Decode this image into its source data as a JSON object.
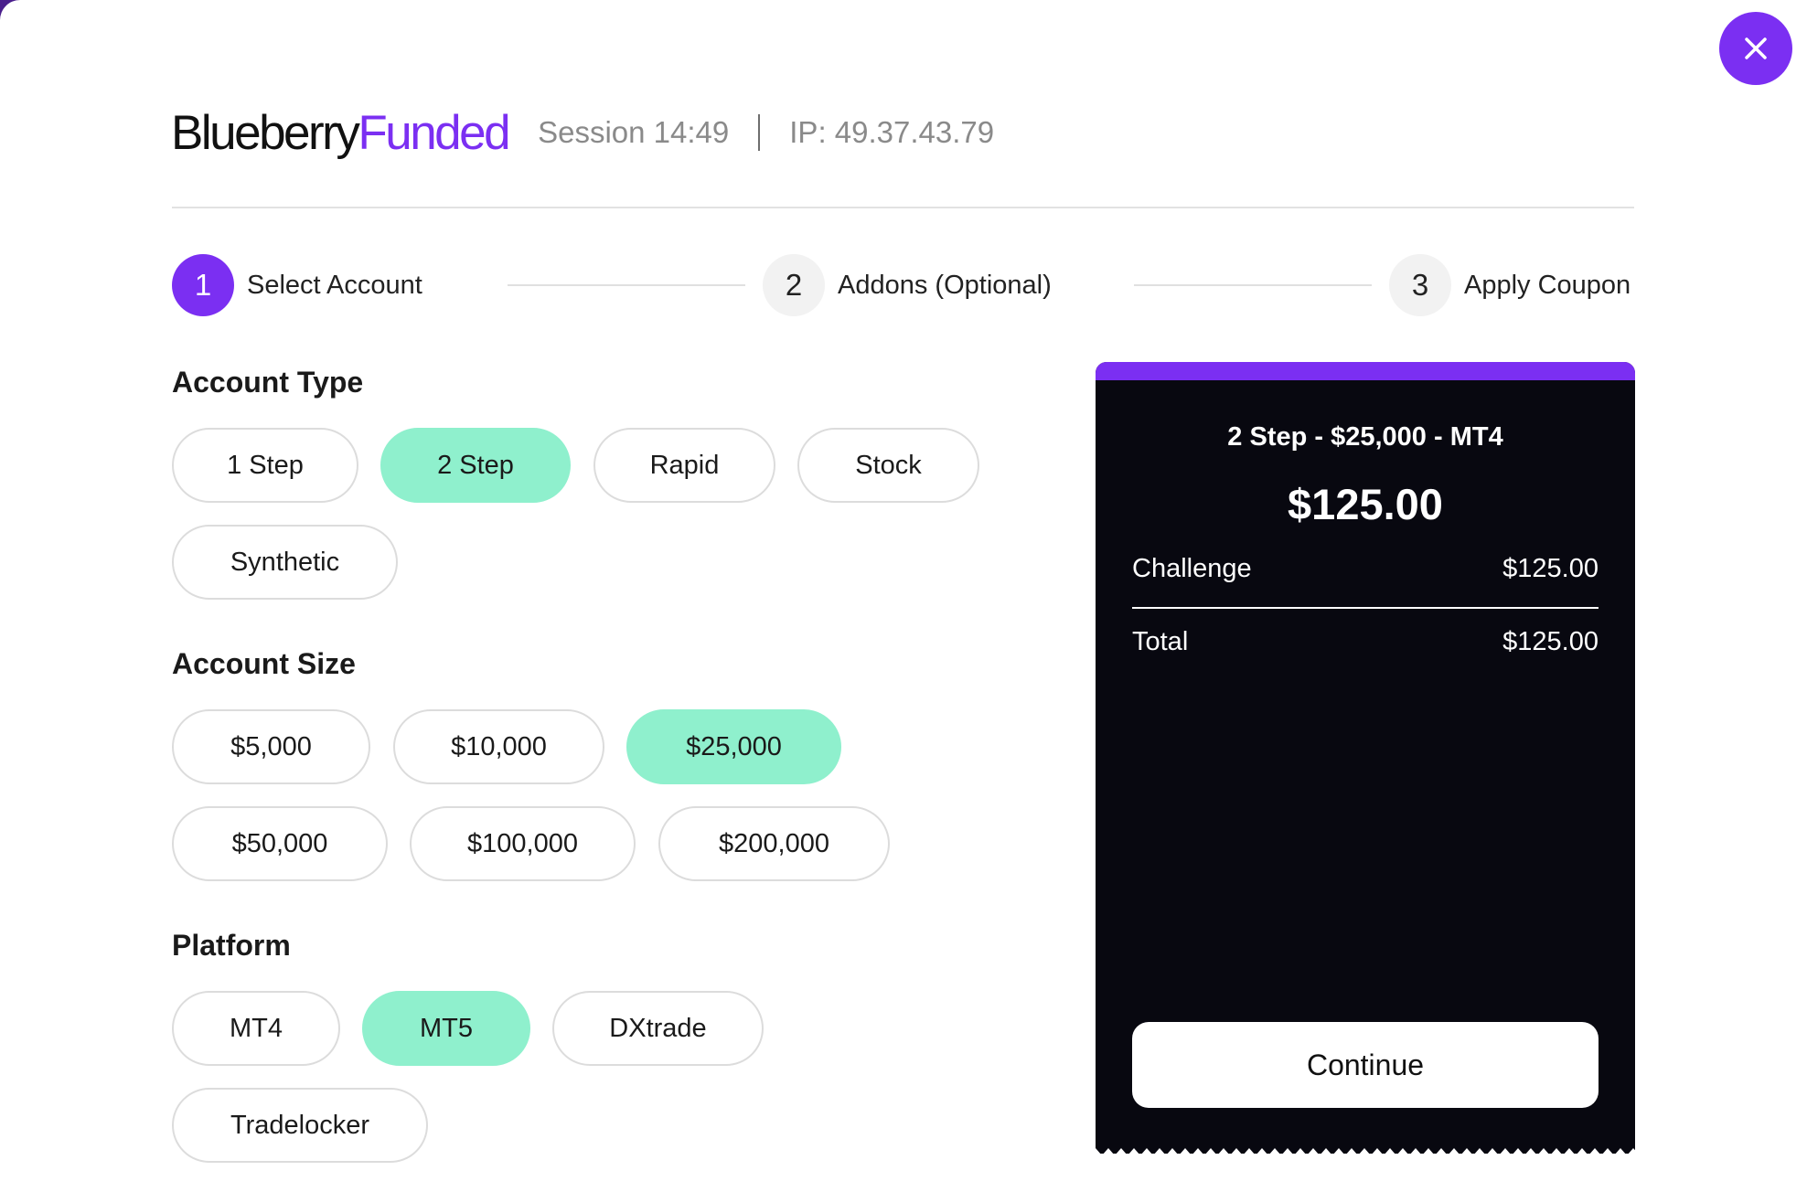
{
  "header": {
    "logo_part1": "Blueberry",
    "logo_part2": "Funded",
    "session": "Session 14:49",
    "ip": "IP: 49.37.43.79"
  },
  "close_icon": "close-icon",
  "steps": [
    {
      "num": "1",
      "label": "Select Account",
      "active": true
    },
    {
      "num": "2",
      "label": "Addons (Optional)",
      "active": false
    },
    {
      "num": "3",
      "label": "Apply Coupon",
      "active": false
    }
  ],
  "account_type": {
    "title": "Account Type",
    "options": [
      "1 Step",
      "2 Step",
      "Rapid",
      "Stock",
      "Synthetic"
    ],
    "selected": "2 Step"
  },
  "account_size": {
    "title": "Account Size",
    "options": [
      "$5,000",
      "$10,000",
      "$25,000",
      "$50,000",
      "$100,000",
      "$200,000"
    ],
    "selected": "$25,000"
  },
  "platform": {
    "title": "Platform",
    "options": [
      "MT4",
      "MT5",
      "DXtrade",
      "Tradelocker"
    ],
    "selected": "MT5"
  },
  "summary": {
    "title": "2 Step - $25,000 - MT4",
    "price": "$125.00",
    "challenge_label": "Challenge",
    "challenge_value": "$125.00",
    "total_label": "Total",
    "total_value": "$125.00",
    "continue_label": "Continue"
  },
  "colors": {
    "accent": "#7b2ff2",
    "selected": "#8ff0cd",
    "panel": "#080810"
  }
}
